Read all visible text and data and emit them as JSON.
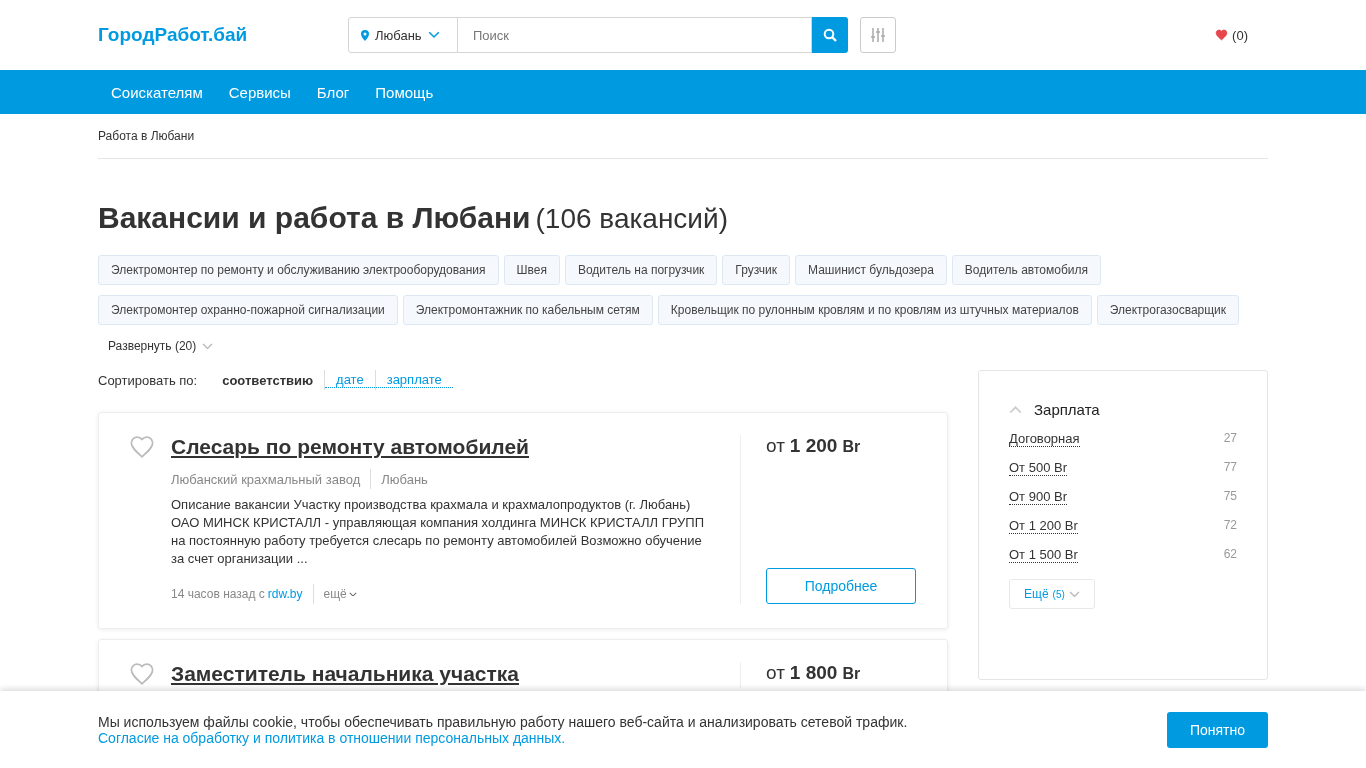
{
  "header": {
    "logo": "ГородРабот.бай",
    "city": "Любань",
    "search": {
      "placeholder": "Поиск"
    },
    "favorites": "(0)"
  },
  "nav": [
    "Соискателям",
    "Сервисы",
    "Блог",
    "Помощь"
  ],
  "breadcrumb": "Работа в Любани",
  "heading": {
    "title": "Вакансии и работа в Любани",
    "count": "(106 вакансий)"
  },
  "tags": [
    "Электромонтер по ремонту и обслуживанию электрооборудования",
    "Швея",
    "Водитель на погрузчик",
    "Грузчик",
    "Машинист бульдозера",
    "Водитель автомобиля",
    "Электромонтер охранно-пожарной сигнализации",
    "Электромонтажник по кабельным сетям",
    "Кровельщик по рулонным кровлям и по кровлям из штучных материалов",
    "Электрогазосварщик"
  ],
  "expand": "Развернуть (20)",
  "sort": {
    "label": "Сортировать по:",
    "options": [
      {
        "label": "соответствию",
        "selected": true
      },
      {
        "label": "дате",
        "selected": false
      },
      {
        "label": "зарплате",
        "selected": false
      }
    ]
  },
  "vacancies": [
    {
      "title": "Слесарь по ремонту автомобилей",
      "company": "Любанский крахмальный завод",
      "city": "Любань",
      "description": "Описание вакансии Участку производства крахмала и крахмалопродуктов (г. Любань) ОАО МИНСК КРИСТАЛЛ - управляющая компания холдинга МИНСК КРИСТАЛЛ ГРУПП на постоянную работу требуется слесарь по ремонту автомобилей Возможно обучение за счет организации ...",
      "posted": "14 часов назад с",
      "source": "rdw.by",
      "more": "ещё",
      "salary_prefix": "от",
      "salary_amount": "1 200",
      "salary_currency": "Br",
      "button": "Подробнее"
    },
    {
      "title": "Заместитель начальника участка",
      "salary_prefix": "от",
      "salary_amount": "1 800",
      "salary_currency": "Br"
    }
  ],
  "filter": {
    "title": "Зарплата",
    "items": [
      {
        "label": "Договорная",
        "count": "27"
      },
      {
        "label": "От 500 Br",
        "count": "77"
      },
      {
        "label": "От 900 Br",
        "count": "75"
      },
      {
        "label": "От 1 200 Br",
        "count": "72"
      },
      {
        "label": "От 1 500 Br",
        "count": "62"
      }
    ],
    "more": "Ещё",
    "more_count": "(5)"
  },
  "cookie": {
    "text": "Мы используем файлы cookie, чтобы обеспечивать правильную работу нашего веб-сайта и анализировать сетевой трафик.",
    "link": "Согласие на обработку и политика в отношении персональных данных.",
    "button": "Понятно"
  }
}
